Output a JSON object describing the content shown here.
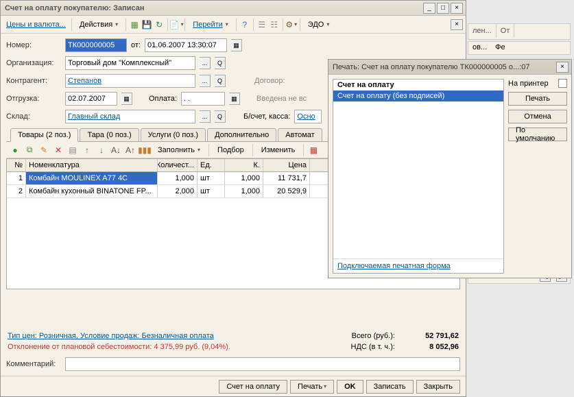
{
  "main": {
    "title": "Счет на оплату покупателю: Записан",
    "toolbar": {
      "prices": "Цены и валюта...",
      "actions": "Действия",
      "goto": "Перейти",
      "edo": "ЭДО"
    },
    "form": {
      "number_label": "Номер:",
      "number": "ТК000000005",
      "from": "от:",
      "date": "01.06.2007 13:30:07",
      "org_label": "Организация:",
      "org": "Торговый дом \"Комплексный\"",
      "counterparty_label": "Контрагент:",
      "counterparty": "Степанов",
      "contract_label": "Договор:",
      "ship_label": "Отгрузка:",
      "ship_date": "02.07.2007",
      "pay_label": "Оплата:",
      "pay_date": ". .",
      "pay_note": "Введена не вс",
      "warehouse_label": "Склад:",
      "warehouse": "Главный склад",
      "bank_label": "Б/счет, касса:",
      "bank": "Осно"
    },
    "tabs": [
      "Товары (2 поз.)",
      "Тара (0 поз.)",
      "Услуги (0 поз.)",
      "Дополнительно",
      "Автомат"
    ],
    "grid_toolbar": {
      "fill": "Заполнить",
      "select": "Подбор",
      "change": "Изменить"
    },
    "grid": {
      "headers": {
        "n": "№",
        "name": "Номенклатура",
        "qty": "Количест...",
        "unit": "Ед.",
        "k": "К.",
        "price": "Цена"
      },
      "rows": [
        {
          "n": "1",
          "name": "Комбайн MOULINEX  A77 4C",
          "qty": "1,000",
          "unit": "шт",
          "k": "1,000",
          "price": "11 731,7"
        },
        {
          "n": "2",
          "name": "Комбайн кухонный BINATONE FP...",
          "qty": "2,000",
          "unit": "шт",
          "k": "1,000",
          "price": "20 529,9"
        }
      ]
    },
    "footer": {
      "price_type": "Тип цен: Розничная, Условие продаж: Безналичная оплата",
      "deviation": "Отклонение от плановой себестоимости: 4 375,99 руб. (9,04%).",
      "total_label": "Всего (руб.):",
      "total": "52 791,62",
      "vat_label": "НДС (в т. ч.):",
      "vat": "8 052,96",
      "comment_label": "Комментарий:"
    },
    "bottom": {
      "invoice": "Счет на оплату",
      "print": "Печать",
      "ok": "OK",
      "save": "Записать",
      "close": "Закрыть"
    }
  },
  "print": {
    "title": "Печать: Счет на оплату покупателю ТК000000005 о...:07",
    "items": [
      "Счет на оплату",
      "Счет на оплату (без подписей)"
    ],
    "footer": "Подключаемая печатная форма",
    "to_printer": "На принтер",
    "print_btn": "Печать",
    "cancel": "Отмена",
    "default": "По умолчанию"
  },
  "bg": {
    "t1": "лен...",
    "t2": "От",
    "t3": "ов...",
    "t4": "Фе"
  }
}
